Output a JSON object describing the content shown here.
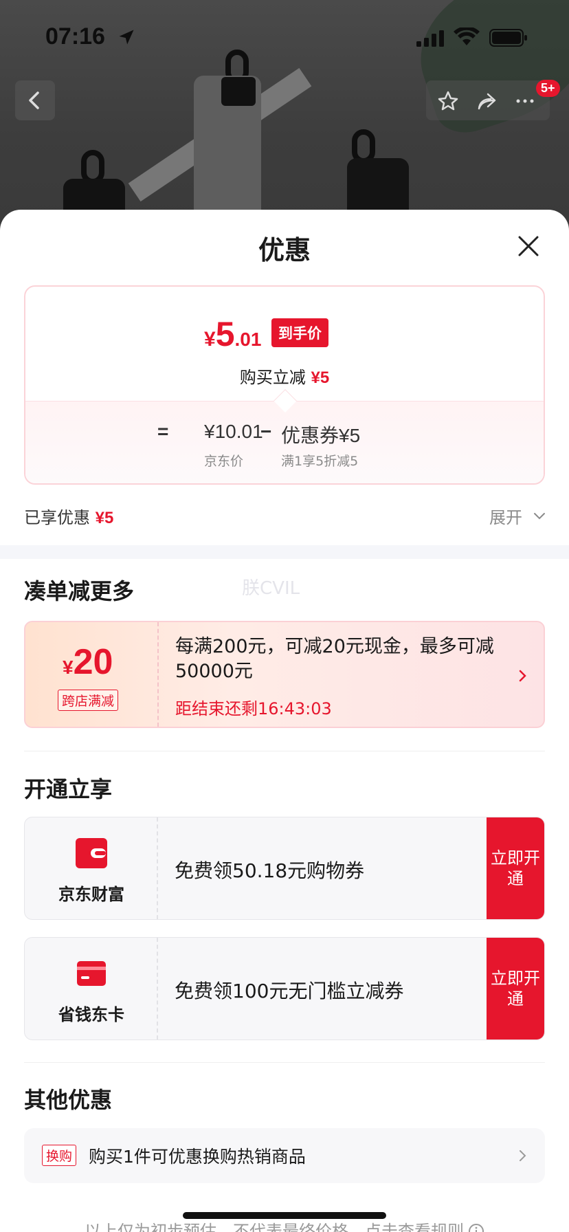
{
  "status_bar": {
    "time": "07:16",
    "notification_count": "5+"
  },
  "sheet": {
    "title": "优惠",
    "price_card": {
      "currency": "¥",
      "final_int": "5",
      "final_dec": ".01",
      "final_tag": "到手价",
      "instant_label": "购买立减",
      "instant_amount": "¥5",
      "equals": "=",
      "base_price": "¥10.01",
      "base_label": "京东价",
      "minus": "−",
      "coupon_value": "优惠券¥5",
      "coupon_rule": "满1享5折减5"
    },
    "enjoyed_label": "已享优惠",
    "enjoyed_amount": "¥5",
    "expand_label": "展开"
  },
  "bundle": {
    "title": "凑单减更多",
    "watermark": "朕CVIL",
    "promo": {
      "currency": "¥",
      "amount": "20",
      "tag": "跨店满减",
      "description": "每满200元，可减20元现金，最多可减50000元",
      "countdown": "距结束还剩16:43:03"
    }
  },
  "open_now": {
    "title": "开通立享",
    "items": [
      {
        "name": "京东财富",
        "description": "免费领50.18元购物券",
        "button": "立即开通",
        "icon": "wallet-icon"
      },
      {
        "name": "省钱东卡",
        "description": "免费领100元无门槛立减券",
        "button": "立即开通",
        "icon": "card-icon"
      }
    ]
  },
  "other": {
    "title": "其他优惠",
    "swap_tag": "换购",
    "swap_text": "购买1件可优惠换购热销商品"
  },
  "footnote": "以上仅为初步预估，不代表最终价格，点击查看规则",
  "colors": {
    "accent": "#e6162d",
    "muted": "#8a8a8a",
    "panel": "#f7f7f9"
  }
}
